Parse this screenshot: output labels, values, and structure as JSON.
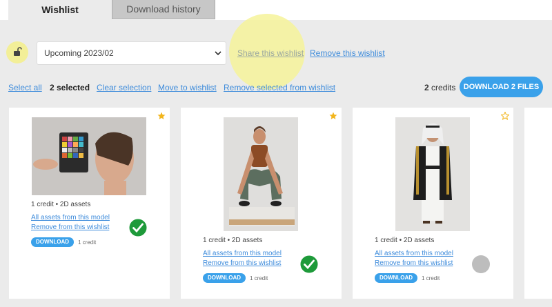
{
  "tabs": [
    {
      "label": "Wishlist",
      "active": true
    },
    {
      "label": "Download history",
      "active": false
    }
  ],
  "wishlist_select": {
    "value": "Upcoming 2023/02"
  },
  "actions": {
    "share": "Share this wishlist",
    "remove": "Remove this wishlist"
  },
  "toolbar": {
    "select_all": "Select all",
    "selected_count": "2 selected",
    "clear_selection": "Clear selection",
    "move_to_wishlist": "Move to wishlist",
    "remove_selected": "Remove selected from wishlist",
    "credits_num": "2",
    "credits_label": "credits",
    "download_files": "DOWNLOAD 2 FILES"
  },
  "cards": [
    {
      "credit": "1 credit",
      "assets": "2D assets",
      "all_assets": "All assets from this model",
      "remove": "Remove from this wishlist",
      "download": "DOWNLOAD",
      "price": "1 credit",
      "selected": true,
      "starred": true
    },
    {
      "credit": "1 credit",
      "assets": "2D assets",
      "all_assets": "All assets from this model",
      "remove": "Remove from this wishlist",
      "download": "DOWNLOAD",
      "price": "1 credit",
      "selected": true,
      "starred": true
    },
    {
      "credit": "1 credit",
      "assets": "2D assets",
      "all_assets": "All assets from this model",
      "remove": "Remove from this wishlist",
      "download": "DOWNLOAD",
      "price": "1 credit",
      "selected": false,
      "starred": false
    }
  ],
  "colors": {
    "accent": "#3aa1ea",
    "check": "#1e9a3a",
    "star": "#f2b51c",
    "highlight": "#f4f08a"
  }
}
